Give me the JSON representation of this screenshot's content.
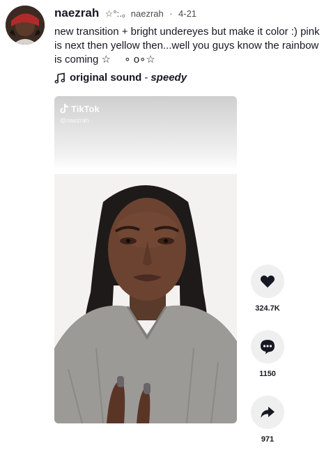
{
  "post": {
    "username": "naezrah",
    "nickname": "☆°:.。naezrah",
    "date": "4-21",
    "caption_lines": [
      "new transition + bright undereyes but make it color :) pink",
      "is next then yellow then...well you guys know the rainbow",
      "is coming ☆ 　∘ o∘☆"
    ],
    "sound": {
      "title": "original sound",
      "separator": "-",
      "artist": "speedy"
    }
  },
  "video": {
    "watermark_brand": "TikTok",
    "watermark_user": "@naezrah"
  },
  "actions": {
    "likes": "324.7K",
    "comments": "1150",
    "shares": "971"
  },
  "icons": {
    "avatar": "user-avatar",
    "music": "music-note-icon",
    "like": "heart-icon",
    "comment": "comment-bubble-icon",
    "share": "share-arrow-icon",
    "watermark": "tiktok-logo-icon"
  },
  "colors": {
    "text": "#161823",
    "button_bg": "#efefef",
    "icon": "#161823"
  }
}
